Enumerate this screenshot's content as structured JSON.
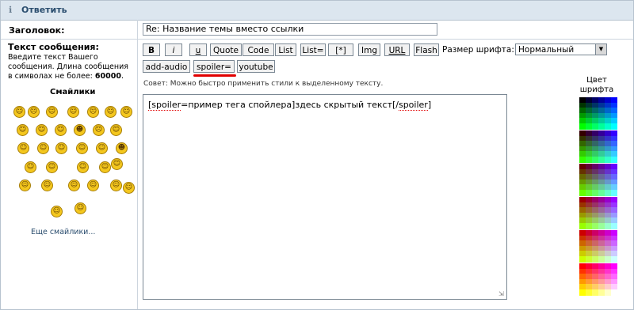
{
  "header": {
    "title": "Ответить",
    "icon": "info-icon"
  },
  "subject": {
    "label": "Заголовок:",
    "value": "Re: Название темы вместо ссылки"
  },
  "message": {
    "label": "Текст сообщения:",
    "description_1": "Введите текст Вашего сообщения. Длина сообщения в символах не более:",
    "max_length": "60000",
    "description_end": "."
  },
  "smilies": {
    "title": "Смайлики",
    "more_link": "Еще смайлики..."
  },
  "toolbar": {
    "buttons": [
      "B",
      "i",
      "u",
      "Quote",
      "Code",
      "List",
      "List=",
      "[*]",
      "Img",
      "URL",
      "Flash"
    ],
    "buttons_row2": [
      "add-audio",
      "spoiler=",
      "youtube"
    ],
    "font_size_label": "Размер шрифта:",
    "font_size_value": "Нормальный"
  },
  "hint": "Совет: Можно быстро применить стили к выделенному тексту.",
  "editor": {
    "text_open": "[spoiler",
    "text_middle": "=пример тега спойлера]здесь скрытый текст[/",
    "text_close": "spoiler",
    "text_end": "]"
  },
  "colors": {
    "title_line1": "Цвет",
    "title_line2": "шрифта",
    "accent_red": "#e10000"
  }
}
